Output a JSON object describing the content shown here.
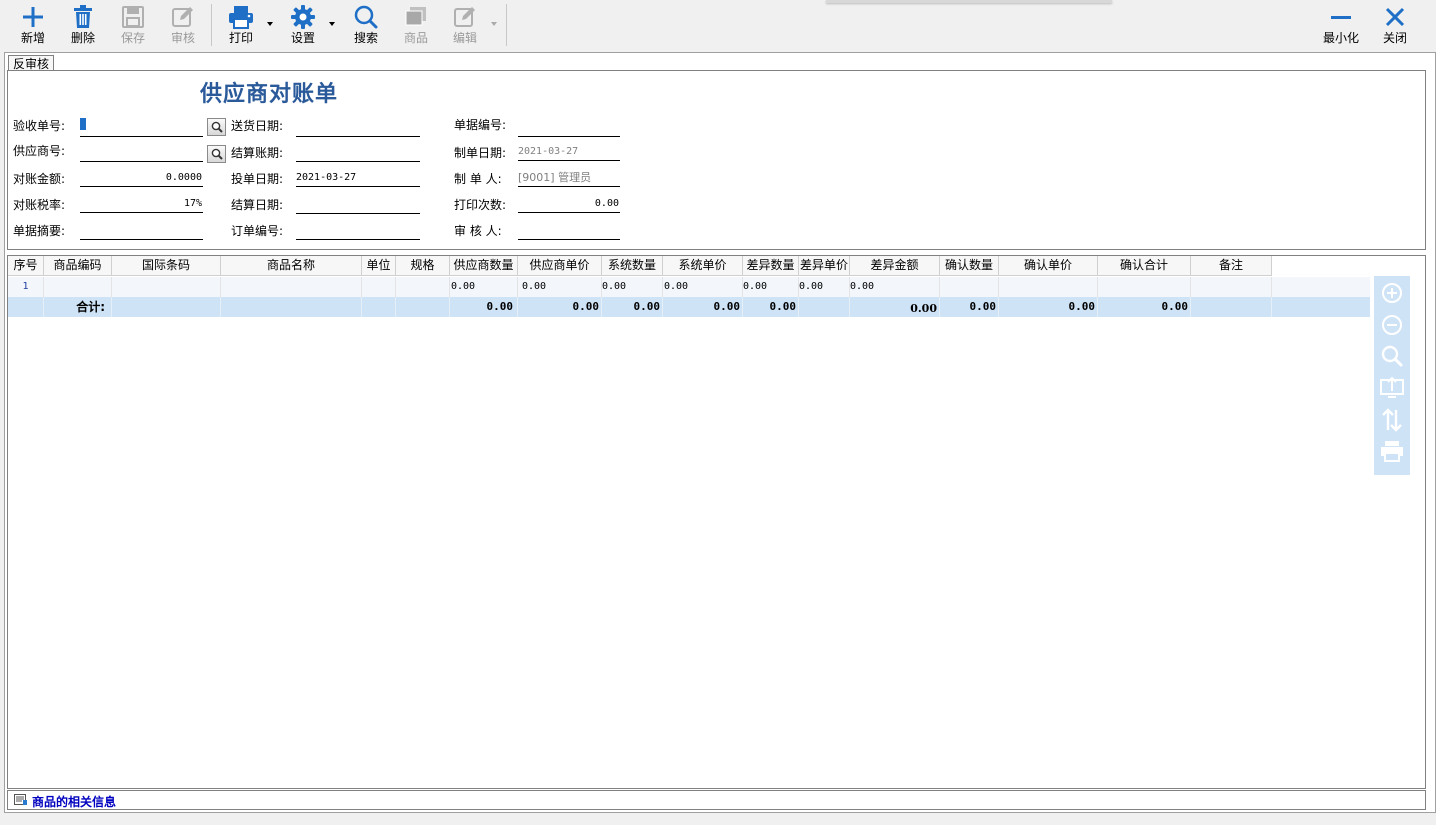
{
  "toolbar": {
    "add_label": "新增",
    "delete_label": "删除",
    "save_label": "保存",
    "audit_label": "审核",
    "print_label": "打印",
    "settings_label": "设置",
    "search_label": "搜索",
    "product_label": "商品",
    "edit_label": "编辑",
    "minimize_label": "最小化",
    "close_label": "关闭"
  },
  "tab": {
    "label": "反审核"
  },
  "form": {
    "title": "供应商对账单",
    "receipt_no": {
      "label": "验收单号:",
      "value": ""
    },
    "supplier_no": {
      "label": "供应商号:",
      "value": ""
    },
    "recon_amount": {
      "label": "对账金额:",
      "value": "0.0000"
    },
    "recon_tax": {
      "label": "对账税率:",
      "value": "17%"
    },
    "summary": {
      "label": "单据摘要:",
      "value": ""
    },
    "delivery_date": {
      "label": "送货日期:",
      "value": ""
    },
    "settle_period": {
      "label": "结算账期:",
      "value": ""
    },
    "submit_date": {
      "label": "投单日期:",
      "value": "2021-03-27"
    },
    "settle_date": {
      "label": "结算日期:",
      "value": ""
    },
    "order_no": {
      "label": "订单编号:",
      "value": ""
    },
    "doc_no": {
      "label": "单据编号:",
      "value": ""
    },
    "create_date": {
      "label": "制单日期:",
      "value": "2021-03-27"
    },
    "creator": {
      "label": "制 单 人:",
      "value": "[9001]  管理员"
    },
    "print_count": {
      "label": "打印次数:",
      "value": "0.00"
    },
    "auditor": {
      "label": "审 核 人:",
      "value": ""
    }
  },
  "grid": {
    "columns": [
      "序号",
      "商品编码",
      "国际条码",
      "商品名称",
      "单位",
      "规格",
      "供应商数量",
      "供应商单价",
      "系统数量",
      "系统单价",
      "差异数量",
      "差异单价",
      "差异金额",
      "确认数量",
      "确认单价",
      "确认合计",
      "备注"
    ],
    "row1": {
      "seq": "1",
      "supplier_qty": "0.00",
      "supplier_price": "0.00",
      "system_qty": "0.00",
      "system_price": "0.00",
      "diff_qty": "0.00",
      "diff_price": "0.00",
      "diff_amount": "0.00"
    },
    "total": {
      "label": "合计:",
      "supplier_qty": "0.00",
      "supplier_price": "0.00",
      "system_qty": "0.00",
      "system_price": "0.00",
      "diff_qty": "0.00",
      "diff_amount": "0.00",
      "confirm_qty": "0.00",
      "confirm_price": "0.00",
      "confirm_total": "0.00"
    }
  },
  "footer": {
    "label": "商品的相关信息"
  },
  "colors": {
    "accent": "#1f6fc7",
    "title": "#2a5a9a",
    "selection": "#cfe3f7"
  }
}
